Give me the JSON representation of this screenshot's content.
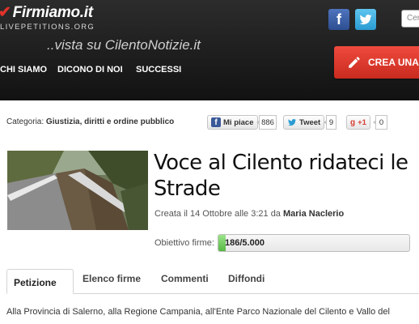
{
  "header": {
    "logo": "Firmiamo.it",
    "logo_sub": "LIVEPETITIONS.ORG",
    "tagline": "..vista su CilentoNotizie.it",
    "search_placeholder": "Cer",
    "nav": [
      "CHI SIAMO",
      "DICONO DI NOI",
      "SUCCESSI"
    ],
    "cta_label": "CREA UNA"
  },
  "category": {
    "label": "Categoria:",
    "value": "Giustizia, diritti e ordine pubblico"
  },
  "social": {
    "like_label": "Mi piace",
    "like_count": "886",
    "tweet_label": "Tweet",
    "tweet_count": "9",
    "gplus_label": "+1",
    "gplus_count": "0"
  },
  "petition": {
    "title": "Voce al Cilento ridateci le Strade",
    "created_prefix": "Creata il 14 Ottobre alle 3:21 da",
    "author": "Maria Naclerio",
    "goal_label": "Obiettivo firme:",
    "goal_text": "186/5.000",
    "goal_progress": 0.0372
  },
  "tabs": [
    "Petizione",
    "Elenco firme",
    "Commenti",
    "Diffondi"
  ],
  "description": "Alla Provincia di Salerno, alla Regione Campania, all'Ente Parco Nazionale del Cilento e Vallo del",
  "colors": {
    "accent_red": "#e0332a",
    "progress_green": "#57b845",
    "facebook": "#3b5998",
    "twitter": "#2a9bd2"
  }
}
